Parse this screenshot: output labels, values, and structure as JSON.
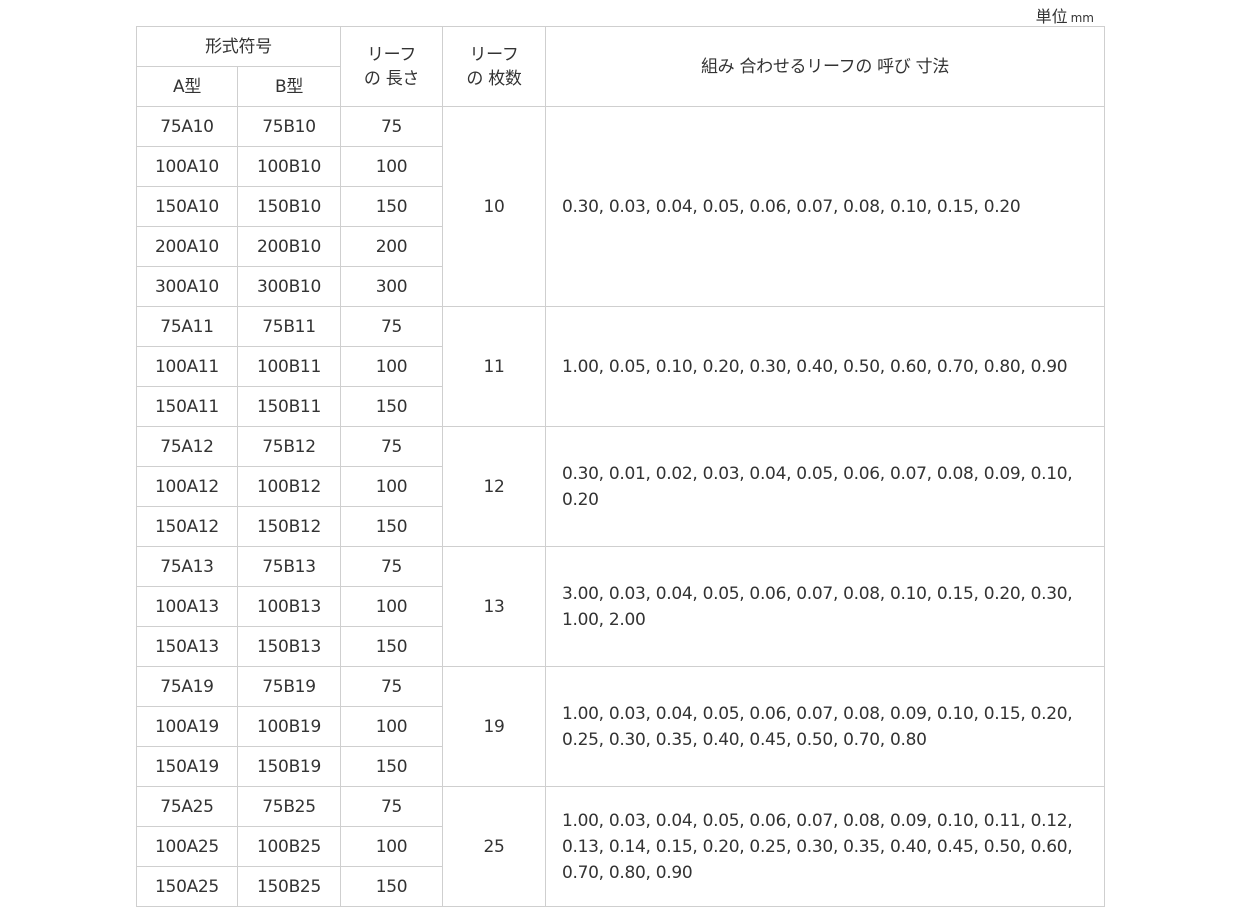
{
  "unit": {
    "label": "単位",
    "value": "mm"
  },
  "header": {
    "model_code": "形式符号",
    "type_a": "A型",
    "type_b": "B型",
    "leaf_length_1": "リーフ",
    "leaf_length_2": "の 長さ",
    "leaf_count_1": "リーフ",
    "leaf_count_2": "の 枚数",
    "combination": "組み 合わせるリーフの 呼び 寸法"
  },
  "groups": [
    {
      "count": "10",
      "sizes": "0.30, 0.03, 0.04, 0.05, 0.06, 0.07, 0.08, 0.10, 0.15, 0.20",
      "rows": [
        {
          "a": "75A10",
          "b": "75B10",
          "len": "75"
        },
        {
          "a": "100A10",
          "b": "100B10",
          "len": "100"
        },
        {
          "a": "150A10",
          "b": "150B10",
          "len": "150"
        },
        {
          "a": "200A10",
          "b": "200B10",
          "len": "200"
        },
        {
          "a": "300A10",
          "b": "300B10",
          "len": "300"
        }
      ]
    },
    {
      "count": "11",
      "sizes": "1.00, 0.05, 0.10, 0.20, 0.30, 0.40, 0.50, 0.60, 0.70, 0.80, 0.90",
      "rows": [
        {
          "a": "75A11",
          "b": "75B11",
          "len": "75"
        },
        {
          "a": "100A11",
          "b": "100B11",
          "len": "100"
        },
        {
          "a": "150A11",
          "b": "150B11",
          "len": "150"
        }
      ]
    },
    {
      "count": "12",
      "sizes": "0.30, 0.01, 0.02, 0.03, 0.04, 0.05, 0.06, 0.07, 0.08, 0.09, 0.10, 0.20",
      "rows": [
        {
          "a": "75A12",
          "b": "75B12",
          "len": "75"
        },
        {
          "a": "100A12",
          "b": "100B12",
          "len": "100"
        },
        {
          "a": "150A12",
          "b": "150B12",
          "len": "150"
        }
      ]
    },
    {
      "count": "13",
      "sizes": "3.00, 0.03, 0.04, 0.05, 0.06, 0.07, 0.08, 0.10, 0.15, 0.20, 0.30, 1.00, 2.00",
      "rows": [
        {
          "a": "75A13",
          "b": "75B13",
          "len": "75"
        },
        {
          "a": "100A13",
          "b": "100B13",
          "len": "100"
        },
        {
          "a": "150A13",
          "b": "150B13",
          "len": "150"
        }
      ]
    },
    {
      "count": "19",
      "sizes": "1.00, 0.03, 0.04, 0.05, 0.06, 0.07, 0.08, 0.09, 0.10, 0.15, 0.20, 0.25, 0.30, 0.35, 0.40, 0.45, 0.50, 0.70, 0.80",
      "rows": [
        {
          "a": "75A19",
          "b": "75B19",
          "len": "75"
        },
        {
          "a": "100A19",
          "b": "100B19",
          "len": "100"
        },
        {
          "a": "150A19",
          "b": "150B19",
          "len": "150"
        }
      ]
    },
    {
      "count": "25",
      "sizes": "1.00, 0.03, 0.04, 0.05, 0.06, 0.07, 0.08, 0.09, 0.10, 0.11, 0.12, 0.13, 0.14, 0.15, 0.20, 0.25, 0.30, 0.35, 0.40, 0.45, 0.50, 0.60, 0.70, 0.80, 0.90",
      "rows": [
        {
          "a": "75A25",
          "b": "75B25",
          "len": "75"
        },
        {
          "a": "100A25",
          "b": "100B25",
          "len": "100"
        },
        {
          "a": "150A25",
          "b": "150B25",
          "len": "150"
        }
      ]
    }
  ]
}
